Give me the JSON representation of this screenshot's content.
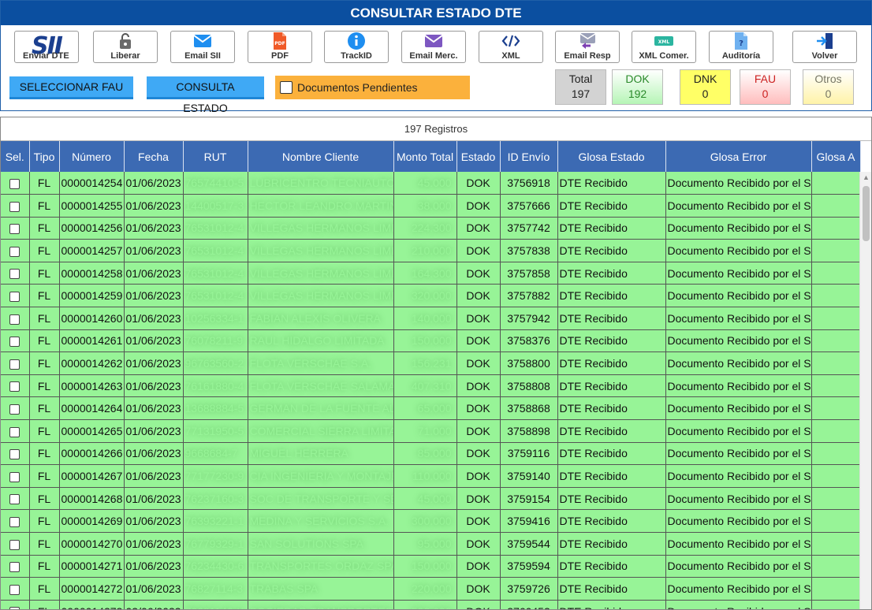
{
  "header": {
    "title": "CONSULTAR ESTADO DTE",
    "toolbar": [
      {
        "label": "Enviar DTE",
        "icon": "sii-logo-icon",
        "name": "enviar-dte-button"
      },
      {
        "label": "Liberar",
        "icon": "unlock-icon",
        "name": "liberar-button"
      },
      {
        "label": "Email SII",
        "icon": "email-icon",
        "name": "email-sii-button"
      },
      {
        "label": "PDF",
        "icon": "pdf-icon",
        "name": "pdf-button"
      },
      {
        "label": "TrackID",
        "icon": "info-icon",
        "name": "trackid-button"
      },
      {
        "label": "Email Merc.",
        "icon": "email-purple-icon",
        "name": "email-merc-button"
      },
      {
        "label": "XML",
        "icon": "code-icon",
        "name": "xml-button"
      },
      {
        "label": "Email Resp",
        "icon": "email-reply-icon",
        "name": "email-resp-button"
      },
      {
        "label": "XML Comer.",
        "icon": "xml-badge-icon",
        "name": "xml-comer-button"
      },
      {
        "label": "Auditoría",
        "icon": "audit-icon",
        "name": "auditoria-button"
      },
      {
        "label": "Volver",
        "icon": "exit-icon",
        "name": "volver-button"
      }
    ],
    "sii_logo_text": "SII",
    "actions": {
      "seleccionar": "SELECCIONAR FAU",
      "consulta": "CONSULTA ESTADO",
      "pendientes": "Documentos Pendientes"
    },
    "stats": [
      {
        "label": "Total",
        "value": "197",
        "bg": "#d3d3d3"
      },
      {
        "label": "DOK",
        "value": "192",
        "bg": "#b6f5b6"
      },
      {
        "label": "DNK",
        "value": "0",
        "bg": "#ffff66"
      },
      {
        "label": "FAU",
        "value": "0",
        "bg": "#ffbdbd"
      },
      {
        "label": "Otros",
        "value": "0",
        "bg": "#fff7b8"
      }
    ]
  },
  "table": {
    "record_count": "197 Registros",
    "columns": [
      "Sel.",
      "Tipo",
      "Número",
      "Fecha",
      "RUT",
      "Nombre Cliente",
      "Monto Total",
      "Estado",
      "ID Envío",
      "Glosa Estado",
      "Glosa Error",
      "Glosa A"
    ],
    "rows": [
      {
        "tipo": "FL",
        "numero": "0000014254",
        "fecha": "01/06/2023",
        "rut": "76574410-5",
        "nombre": "LUBRICENTRO TECNIAUTO",
        "monto": "45.000",
        "estado": "DOK",
        "id_envio": "3756918",
        "glosa_estado": "DTE Recibido",
        "glosa_error": "Documento Recibido por el SII"
      },
      {
        "tipo": "FL",
        "numero": "0000014255",
        "fecha": "01/06/2023",
        "rut": "14400517-3",
        "nombre": "HECTOR LEANDRO MARTINEZ",
        "monto": "38.000",
        "estado": "DOK",
        "id_envio": "3757666",
        "glosa_estado": "DTE Recibido",
        "glosa_error": "Documento Recibido por el SII"
      },
      {
        "tipo": "FL",
        "numero": "0000014256",
        "fecha": "01/06/2023",
        "rut": "76531012-4",
        "nombre": "VILLEGAS HERMANOS LIMITADA",
        "monto": "224.300",
        "estado": "DOK",
        "id_envio": "3757742",
        "glosa_estado": "DTE Recibido",
        "glosa_error": "Documento Recibido por el SII"
      },
      {
        "tipo": "FL",
        "numero": "0000014257",
        "fecha": "01/06/2023",
        "rut": "76531012-4",
        "nombre": "VILLEGAS HERMANOS LIMITADA",
        "monto": "210.000",
        "estado": "DOK",
        "id_envio": "3757838",
        "glosa_estado": "DTE Recibido",
        "glosa_error": "Documento Recibido por el SII"
      },
      {
        "tipo": "FL",
        "numero": "0000014258",
        "fecha": "01/06/2023",
        "rut": "76531012-4",
        "nombre": "VILLEGAS HERMANOS LIMITADA",
        "monto": "164.300",
        "estado": "DOK",
        "id_envio": "3757858",
        "glosa_estado": "DTE Recibido",
        "glosa_error": "Documento Recibido por el SII"
      },
      {
        "tipo": "FL",
        "numero": "0000014259",
        "fecha": "01/06/2023",
        "rut": "76531012-4",
        "nombre": "VILLEGAS HERMANOS LIMITADA",
        "monto": "320.000",
        "estado": "DOK",
        "id_envio": "3757882",
        "glosa_estado": "DTE Recibido",
        "glosa_error": "Documento Recibido por el SII"
      },
      {
        "tipo": "FL",
        "numero": "0000014260",
        "fecha": "01/06/2023",
        "rut": "10256334-1",
        "nombre": "FABIAN ALEXIS OLIVERA",
        "monto": "140.000",
        "estado": "DOK",
        "id_envio": "3757942",
        "glosa_estado": "DTE Recibido",
        "glosa_error": "Documento Recibido por el SII"
      },
      {
        "tipo": "FL",
        "numero": "0000014261",
        "fecha": "01/06/2023",
        "rut": "76078211-9",
        "nombre": "RAUL HIDALGO LIMITADA",
        "monto": "150.000",
        "estado": "DOK",
        "id_envio": "3758376",
        "glosa_estado": "DTE Recibido",
        "glosa_error": "Documento Recibido por el SII"
      },
      {
        "tipo": "FL",
        "numero": "0000014262",
        "fecha": "01/06/2023",
        "rut": "96763560-2",
        "nombre": "FLOTA VERSCHAE S.A.",
        "monto": "156.231",
        "estado": "DOK",
        "id_envio": "3758800",
        "glosa_estado": "DTE Recibido",
        "glosa_error": "Documento Recibido por el SII"
      },
      {
        "tipo": "FL",
        "numero": "0000014263",
        "fecha": "01/06/2023",
        "rut": "76161880-4",
        "nombre": "FLOTA VERSCHAE SALAMANCA",
        "monto": "407.310",
        "estado": "DOK",
        "id_envio": "3758808",
        "glosa_estado": "DTE Recibido",
        "glosa_error": "Documento Recibido por el SII"
      },
      {
        "tipo": "FL",
        "numero": "0000014264",
        "fecha": "01/06/2023",
        "rut": "13688884-5",
        "nombre": "GERMAN DE LA FUENTE ALONSO",
        "monto": "65.000",
        "estado": "DOK",
        "id_envio": "3758868",
        "glosa_estado": "DTE Recibido",
        "glosa_error": "Documento Recibido por el SII"
      },
      {
        "tipo": "FL",
        "numero": "0000014265",
        "fecha": "01/06/2023",
        "rut": "77131950-5",
        "nombre": "COMERCIAL SIERRA LIMITADA",
        "monto": "71.000",
        "estado": "DOK",
        "id_envio": "3758898",
        "glosa_estado": "DTE Recibido",
        "glosa_error": "Documento Recibido por el SII"
      },
      {
        "tipo": "FL",
        "numero": "0000014266",
        "fecha": "01/06/2023",
        "rut": "9668684-7",
        "nombre": "MIGUEL HERRERA",
        "monto": "85.000",
        "estado": "DOK",
        "id_envio": "3759116",
        "glosa_estado": "DTE Recibido",
        "glosa_error": "Documento Recibido por el SII"
      },
      {
        "tipo": "FL",
        "numero": "0000014267",
        "fecha": "01/06/2023",
        "rut": "77177230-9",
        "nombre": "CIA INGENIERIA Y MONTAJES C",
        "monto": "110.000",
        "estado": "DOK",
        "id_envio": "3759140",
        "glosa_estado": "DTE Recibido",
        "glosa_error": "Documento Recibido por el SII"
      },
      {
        "tipo": "FL",
        "numero": "0000014268",
        "fecha": "01/06/2023",
        "rut": "76237160-3",
        "nombre": "SOC DE TRANSPORTE Y SERV",
        "monto": "45.000",
        "estado": "DOK",
        "id_envio": "3759154",
        "glosa_estado": "DTE Recibido",
        "glosa_error": "Documento Recibido por el SII"
      },
      {
        "tipo": "FL",
        "numero": "0000014269",
        "fecha": "01/06/2023",
        "rut": "76393221-1",
        "nombre": "MEDINA Y SERVICIOS S.A.",
        "monto": "300.000",
        "estado": "DOK",
        "id_envio": "3759416",
        "glosa_estado": "DTE Recibido",
        "glosa_error": "Documento Recibido por el SII"
      },
      {
        "tipo": "FL",
        "numero": "0000014270",
        "fecha": "01/06/2023",
        "rut": "76779329-1",
        "nombre": "SAN SOLUTIONS SPA",
        "monto": "95.000",
        "estado": "DOK",
        "id_envio": "3759544",
        "glosa_estado": "DTE Recibido",
        "glosa_error": "Documento Recibido por el SII"
      },
      {
        "tipo": "FL",
        "numero": "0000014271",
        "fecha": "01/06/2023",
        "rut": "76234430-6",
        "nombre": "TRANSPORTES ORDAZ SPA",
        "monto": "150.000",
        "estado": "DOK",
        "id_envio": "3759594",
        "glosa_estado": "DTE Recibido",
        "glosa_error": "Documento Recibido por el SII"
      },
      {
        "tipo": "FL",
        "numero": "0000014272",
        "fecha": "01/06/2023",
        "rut": "76827114-3",
        "nombre": "TRABAS SPA",
        "monto": "220.000",
        "estado": "DOK",
        "id_envio": "3759726",
        "glosa_estado": "DTE Recibido",
        "glosa_error": "Documento Recibido por el SII"
      },
      {
        "tipo": "FL",
        "numero": "0000014273",
        "fecha": "02/06/2023",
        "rut": "76681140-K",
        "nombre": "SOCIEDAD TRANSPORTES",
        "monto": "592.620",
        "estado": "DOK",
        "id_envio": "3760452",
        "glosa_estado": "DTE Recibido",
        "glosa_error": "Documento Recibido por el SII"
      }
    ]
  },
  "colors": {
    "title_bar": "#0b4fa0",
    "header_row": "#3c6ab3",
    "row_dok": "#97f497",
    "action_button": "#3fa9f5",
    "pending_bg": "#fbb13c"
  }
}
